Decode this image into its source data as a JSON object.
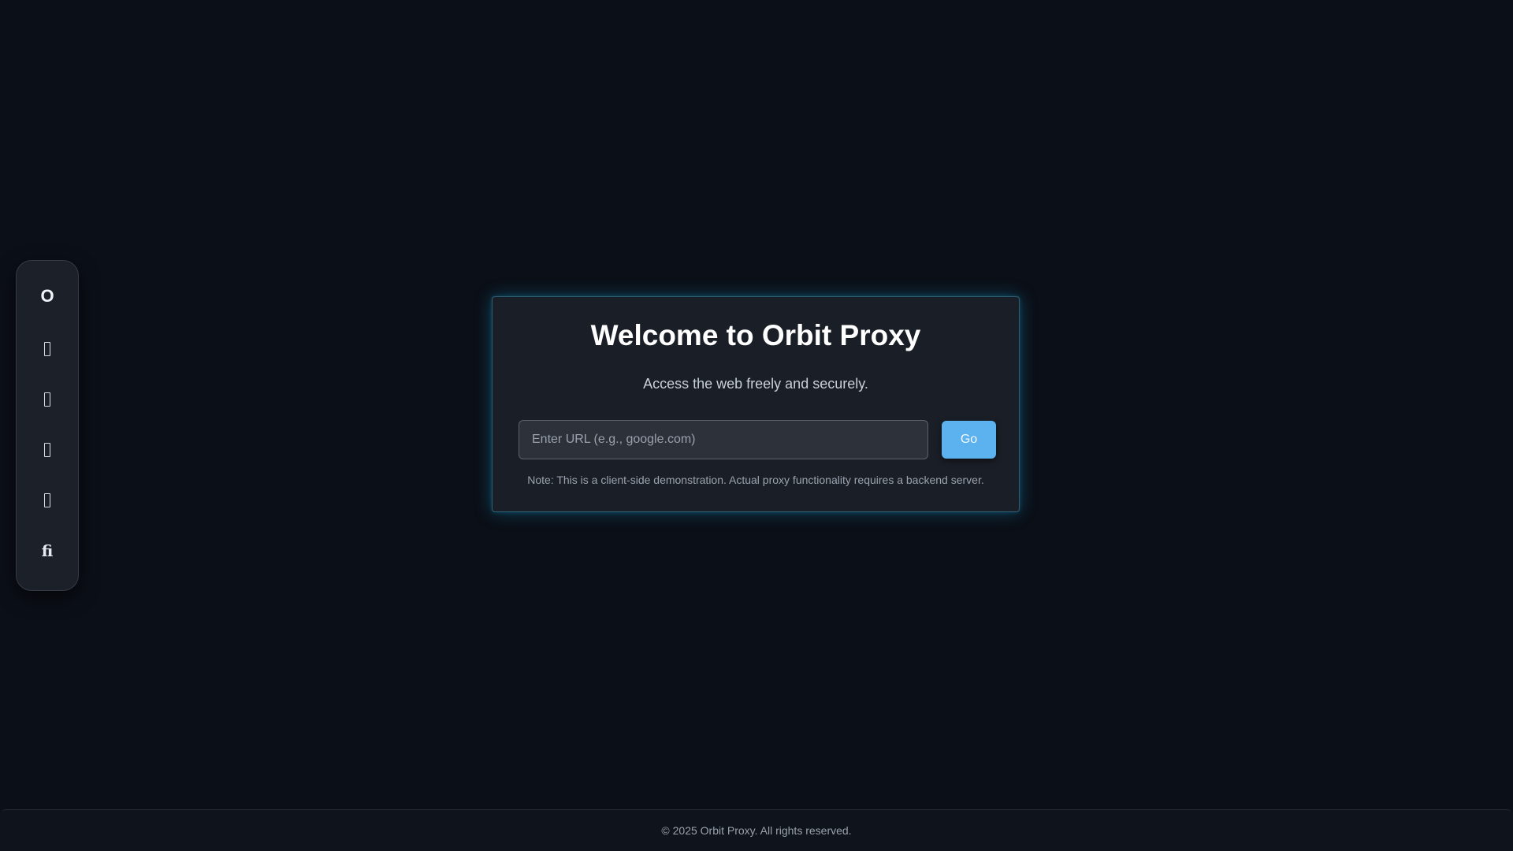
{
  "sidebar": {
    "logo": "O",
    "items": [
      {
        "icon": "nav-icon-1",
        "glyph": ""
      },
      {
        "icon": "nav-icon-2",
        "glyph": ""
      },
      {
        "icon": "nav-icon-3",
        "glyph": ""
      },
      {
        "icon": "nav-icon-4",
        "glyph": ""
      },
      {
        "icon": "fi-ligature-icon",
        "glyph": "ﬁ"
      }
    ]
  },
  "main": {
    "title": "Welcome to Orbit Proxy",
    "subtitle": "Access the web freely and securely.",
    "url_input": {
      "value": "",
      "placeholder": "Enter URL (e.g., google.com)"
    },
    "go_label": "Go",
    "note": "Note: This is a client-side demonstration. Actual proxy functionality requires a backend server."
  },
  "footer": {
    "text": "© 2025 Orbit Proxy. All rights reserved."
  },
  "colors": {
    "background": "#0b0f17",
    "card": "#1a1e26",
    "accent": "#5cb2ee",
    "glow": "#18aadc"
  }
}
